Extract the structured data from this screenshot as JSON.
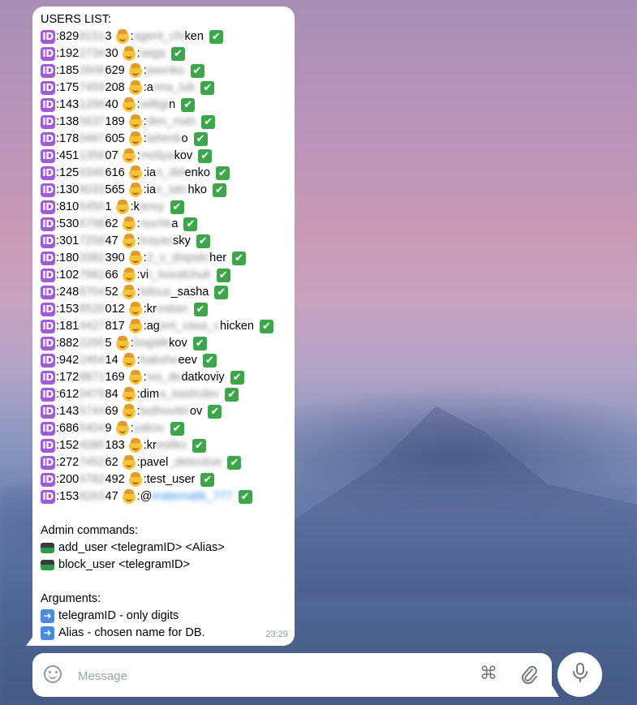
{
  "message": {
    "header": "USERS LIST:",
    "users": [
      {
        "id_prefix": ":829",
        "id_blur": "8151",
        "id_suffix": "3",
        "alias_prefix": ":",
        "alias_blur": "agent_chi",
        "alias_suffix": "ken"
      },
      {
        "id_prefix": ":192",
        "id_blur": "2734",
        "id_suffix": "30",
        "alias_prefix": ":",
        "alias_blur": "taiga",
        "alias_suffix": ""
      },
      {
        "id_prefix": ":185",
        "id_blur": "2606",
        "id_suffix": "629",
        "alias_prefix": ":",
        "alias_blur": "pasnko",
        "alias_suffix": ""
      },
      {
        "id_prefix": ":175",
        "id_blur": "7459",
        "id_suffix": "208",
        "alias_prefix": ":a",
        "alias_blur": "nna_lub",
        "alias_suffix": ""
      },
      {
        "id_prefix": ":143",
        "id_blur": "1299",
        "id_suffix": "40",
        "alias_prefix": ":",
        "alias_blur": "wiltigi",
        "alias_suffix": "n"
      },
      {
        "id_prefix": ":138",
        "id_blur": "5637",
        "id_suffix": "189",
        "alias_prefix": ":",
        "alias_blur": "den_mah",
        "alias_suffix": ""
      },
      {
        "id_prefix": ":178",
        "id_blur": "0467",
        "id_suffix": "605",
        "alias_prefix": ":",
        "alias_blur": "lahenk",
        "alias_suffix": "o"
      },
      {
        "id_prefix": ":451",
        "id_blur": "1356",
        "id_suffix": "07",
        "alias_prefix": ":",
        "alias_blur": "moliya",
        "alias_suffix": "kov"
      },
      {
        "id_prefix": ":125",
        "id_blur": "6346",
        "id_suffix": "616",
        "alias_prefix": ":ia",
        "alias_blur": "n_did",
        "alias_suffix": "enko"
      },
      {
        "id_prefix": ":130",
        "id_blur": "9033",
        "id_suffix": "565",
        "alias_prefix": ":ia",
        "alias_blur": "n_tatc",
        "alias_suffix": "hko"
      },
      {
        "id_prefix": ":810",
        "id_blur": "5450",
        "id_suffix": "1",
        "alias_prefix": ":k",
        "alias_blur": "ansy",
        "alias_suffix": ""
      },
      {
        "id_prefix": ":530",
        "id_blur": "6798",
        "id_suffix": "62",
        "alias_prefix": ":",
        "alias_blur": "nuchk",
        "alias_suffix": "a"
      },
      {
        "id_prefix": ":301",
        "id_blur": "7258",
        "id_suffix": "47",
        "alias_prefix": ":",
        "alias_blur": "troyan",
        "alias_suffix": "sky"
      },
      {
        "id_prefix": ":180",
        "id_blur": "3382",
        "id_suffix": "390",
        "alias_prefix": ":",
        "alias_blur": "2_v_dispatc",
        "alias_suffix": "her"
      },
      {
        "id_prefix": ":102",
        "id_blur": "7962",
        "id_suffix": "66",
        "alias_prefix": ":vi",
        "alias_blur": "t_kovalchuk",
        "alias_suffix": ""
      },
      {
        "id_prefix": ":248",
        "id_blur": "8704",
        "id_suffix": "52",
        "alias_prefix": ":",
        "alias_blur": "bilous",
        "alias_suffix": "_sasha"
      },
      {
        "id_prefix": ":153",
        "id_blur": "8520",
        "id_suffix": "012",
        "alias_prefix": ":kr",
        "alias_blur": "ostian",
        "alias_suffix": ""
      },
      {
        "id_prefix": ":181",
        "id_blur": "4427",
        "id_suffix": "817",
        "alias_prefix": ":ag",
        "alias_blur": "ent_vasa_c",
        "alias_suffix": "hicken"
      },
      {
        "id_prefix": ":882",
        "id_blur": "2295",
        "id_suffix": "5",
        "alias_prefix": ":",
        "alias_blur": "bogatk",
        "alias_suffix": "kov"
      },
      {
        "id_prefix": ":942",
        "id_blur": "2464",
        "id_suffix": "14",
        "alias_prefix": ":",
        "alias_blur": "bakshe",
        "alias_suffix": "eev"
      },
      {
        "id_prefix": ":172",
        "id_blur": "8871",
        "id_suffix": "169",
        "alias_prefix": ":",
        "alias_blur": "ivo_do",
        "alias_suffix": "datkoviy"
      },
      {
        "id_prefix": ":612",
        "id_blur": "0479",
        "id_suffix": "84",
        "alias_prefix": ":dim",
        "alias_blur": "a_kastrulev",
        "alias_suffix": ""
      },
      {
        "id_prefix": ":143",
        "id_blur": "5744",
        "id_suffix": "69",
        "alias_prefix": ":",
        "alias_blur": "bolhovitin",
        "alias_suffix": "ov"
      },
      {
        "id_prefix": ":686",
        "id_blur": "5404",
        "id_suffix": "9",
        "alias_prefix": ":",
        "alias_blur": "yakov",
        "alias_suffix": ""
      },
      {
        "id_prefix": ":152",
        "id_blur": "4085",
        "id_suffix": "183",
        "alias_prefix": ":kr",
        "alias_blur": "esliko",
        "alias_suffix": ""
      },
      {
        "id_prefix": ":272",
        "id_blur": "7452",
        "id_suffix": "62",
        "alias_prefix": ":pavel",
        "alias_blur": "_detective",
        "alias_suffix": ""
      },
      {
        "id_prefix": ":200",
        "id_blur": "4782",
        "id_suffix": "492",
        "alias_prefix": ":test_user",
        "alias_blur": "",
        "alias_suffix": ""
      },
      {
        "id_prefix": ":153",
        "id_blur": "8263",
        "id_suffix": "47",
        "alias_prefix": ":@",
        "alias_blur": "matematik_777",
        "alias_suffix": "",
        "alias_is_link": true
      }
    ],
    "id_badge_label": "ID",
    "check_icon": "white-heavy-check-mark-icon",
    "admin_header": "Admin commands:",
    "commands": [
      {
        "text": "add_user <telegramID> <Alias>",
        "icon": "keyboard-icon"
      },
      {
        "text": "block_user <telegramID>",
        "icon": "keyboard-icon"
      }
    ],
    "arguments_header": "Arguments:",
    "arguments": [
      {
        "text": "telegramID - only digits",
        "icon": "right-arrow-icon"
      },
      {
        "text": "Alias - chosen name for DB.",
        "icon": "right-arrow-icon"
      }
    ],
    "time": "23:29"
  },
  "composer": {
    "placeholder": "Message",
    "value": ""
  },
  "colors": {
    "bubble": "#ffffff",
    "id_badge": "#a25ad6",
    "check": "#3ea64a",
    "link": "#3390ec",
    "icon_gray": "#8e9aa4"
  }
}
